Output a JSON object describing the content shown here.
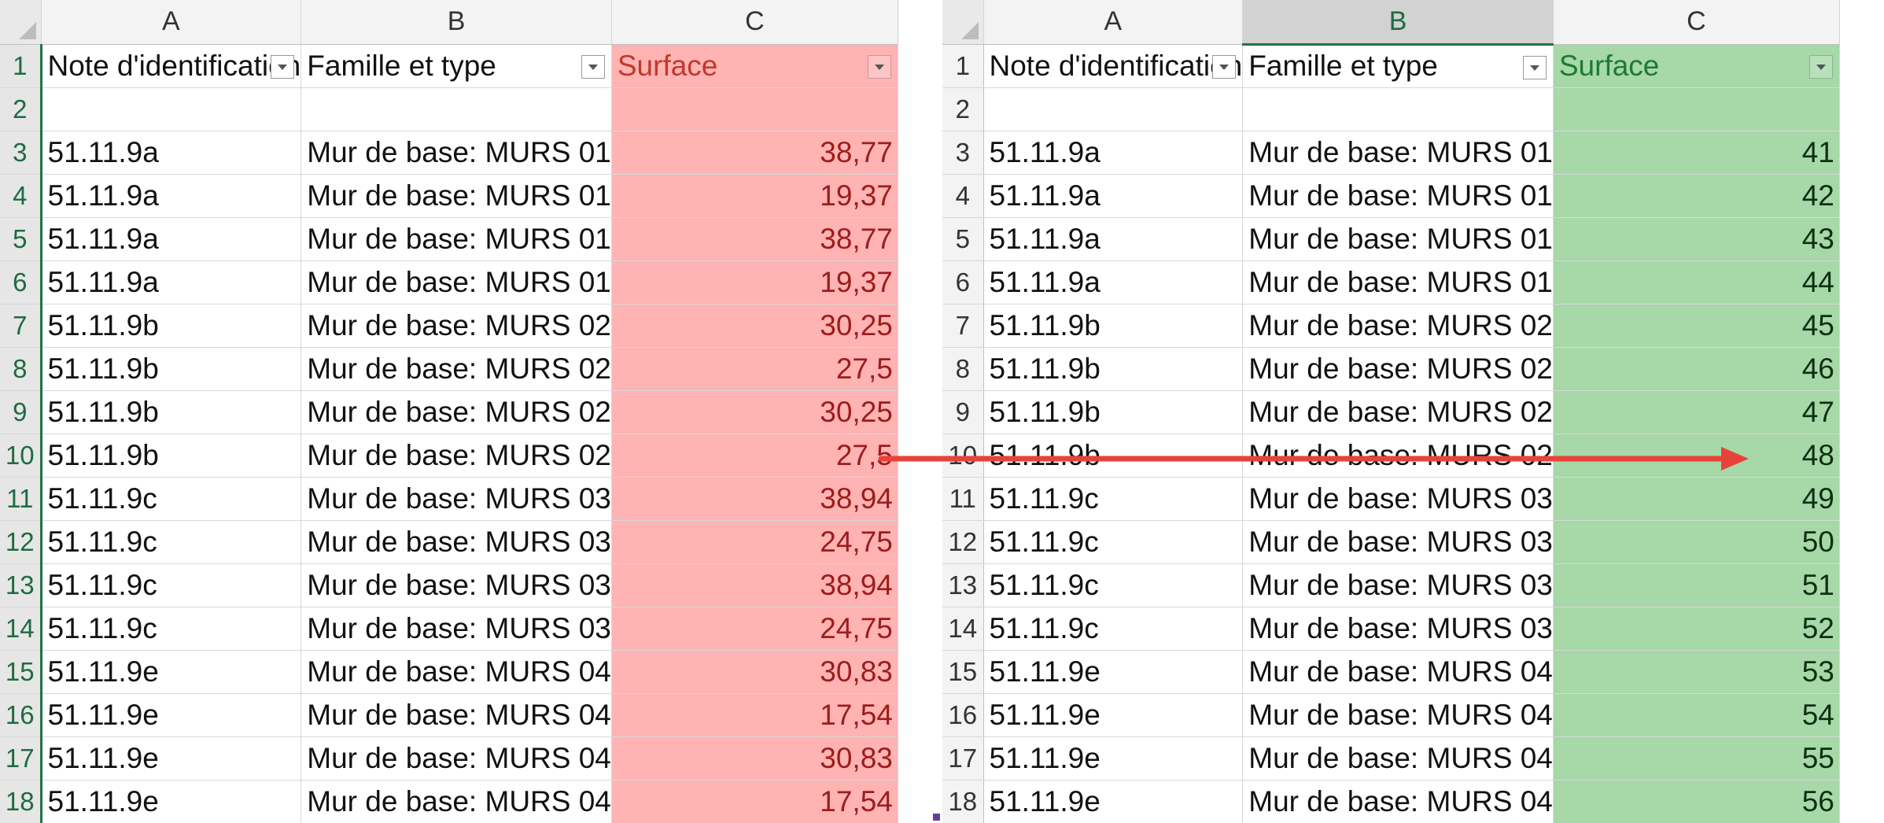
{
  "left_sheet": {
    "column_letters": [
      "A",
      "B",
      "C"
    ],
    "header": {
      "row_number": "1",
      "a": "Note d'identification",
      "b": "Famille et type",
      "c": "Surface"
    },
    "blank_row_number": "2",
    "rows": [
      {
        "n": "3",
        "a": "51.11.9a",
        "b": "Mur de base: MURS 01",
        "c": "38,77"
      },
      {
        "n": "4",
        "a": "51.11.9a",
        "b": "Mur de base: MURS 01",
        "c": "19,37"
      },
      {
        "n": "5",
        "a": "51.11.9a",
        "b": "Mur de base: MURS 01",
        "c": "38,77"
      },
      {
        "n": "6",
        "a": "51.11.9a",
        "b": "Mur de base: MURS 01",
        "c": "19,37"
      },
      {
        "n": "7",
        "a": "51.11.9b",
        "b": "Mur de base: MURS 02",
        "c": "30,25"
      },
      {
        "n": "8",
        "a": "51.11.9b",
        "b": "Mur de base: MURS 02",
        "c": "27,5"
      },
      {
        "n": "9",
        "a": "51.11.9b",
        "b": "Mur de base: MURS 02",
        "c": "30,25"
      },
      {
        "n": "10",
        "a": "51.11.9b",
        "b": "Mur de base: MURS 02",
        "c": "27,5"
      },
      {
        "n": "11",
        "a": "51.11.9c",
        "b": "Mur de base: MURS 03",
        "c": "38,94"
      },
      {
        "n": "12",
        "a": "51.11.9c",
        "b": "Mur de base: MURS 03",
        "c": "24,75"
      },
      {
        "n": "13",
        "a": "51.11.9c",
        "b": "Mur de base: MURS 03",
        "c": "38,94"
      },
      {
        "n": "14",
        "a": "51.11.9c",
        "b": "Mur de base: MURS 03",
        "c": "24,75"
      },
      {
        "n": "15",
        "a": "51.11.9e",
        "b": "Mur de base: MURS 04",
        "c": "30,83"
      },
      {
        "n": "16",
        "a": "51.11.9e",
        "b": "Mur de base: MURS 04",
        "c": "17,54"
      },
      {
        "n": "17",
        "a": "51.11.9e",
        "b": "Mur de base: MURS 04",
        "c": "30,83"
      },
      {
        "n": "18",
        "a": "51.11.9e",
        "b": "Mur de base: MURS 04",
        "c": "17,54"
      }
    ]
  },
  "right_sheet": {
    "column_letters": [
      "A",
      "B",
      "C"
    ],
    "header": {
      "row_number": "1",
      "a": "Note d'identification",
      "b": "Famille et type",
      "c": "Surface"
    },
    "blank_row_number": "2",
    "rows": [
      {
        "n": "3",
        "a": "51.11.9a",
        "b": "Mur de base: MURS 01",
        "c": "41"
      },
      {
        "n": "4",
        "a": "51.11.9a",
        "b": "Mur de base: MURS 01",
        "c": "42"
      },
      {
        "n": "5",
        "a": "51.11.9a",
        "b": "Mur de base: MURS 01",
        "c": "43"
      },
      {
        "n": "6",
        "a": "51.11.9a",
        "b": "Mur de base: MURS 01",
        "c": "44"
      },
      {
        "n": "7",
        "a": "51.11.9b",
        "b": "Mur de base: MURS 02",
        "c": "45"
      },
      {
        "n": "8",
        "a": "51.11.9b",
        "b": "Mur de base: MURS 02",
        "c": "46"
      },
      {
        "n": "9",
        "a": "51.11.9b",
        "b": "Mur de base: MURS 02",
        "c": "47"
      },
      {
        "n": "10",
        "a": "51.11.9b",
        "b": "Mur de base: MURS 02",
        "c": "48"
      },
      {
        "n": "11",
        "a": "51.11.9c",
        "b": "Mur de base: MURS 03",
        "c": "49"
      },
      {
        "n": "12",
        "a": "51.11.9c",
        "b": "Mur de base: MURS 03",
        "c": "50"
      },
      {
        "n": "13",
        "a": "51.11.9c",
        "b": "Mur de base: MURS 03",
        "c": "51"
      },
      {
        "n": "14",
        "a": "51.11.9c",
        "b": "Mur de base: MURS 03",
        "c": "52"
      },
      {
        "n": "15",
        "a": "51.11.9e",
        "b": "Mur de base: MURS 04",
        "c": "53"
      },
      {
        "n": "16",
        "a": "51.11.9e",
        "b": "Mur de base: MURS 04",
        "c": "54"
      },
      {
        "n": "17",
        "a": "51.11.9e",
        "b": "Mur de base: MURS 04",
        "c": "55"
      },
      {
        "n": "18",
        "a": "51.11.9e",
        "b": "Mur de base: MURS 04",
        "c": "56"
      }
    ]
  },
  "colors": {
    "left_surface_fill": "#ffb3b3",
    "right_surface_fill": "#a6d8a8",
    "arrow": "#e8433a",
    "excel_green": "#217346"
  },
  "icons": {
    "filter_dropdown": "chevron-down-icon",
    "annotation_arrow": "arrow-right-icon"
  }
}
